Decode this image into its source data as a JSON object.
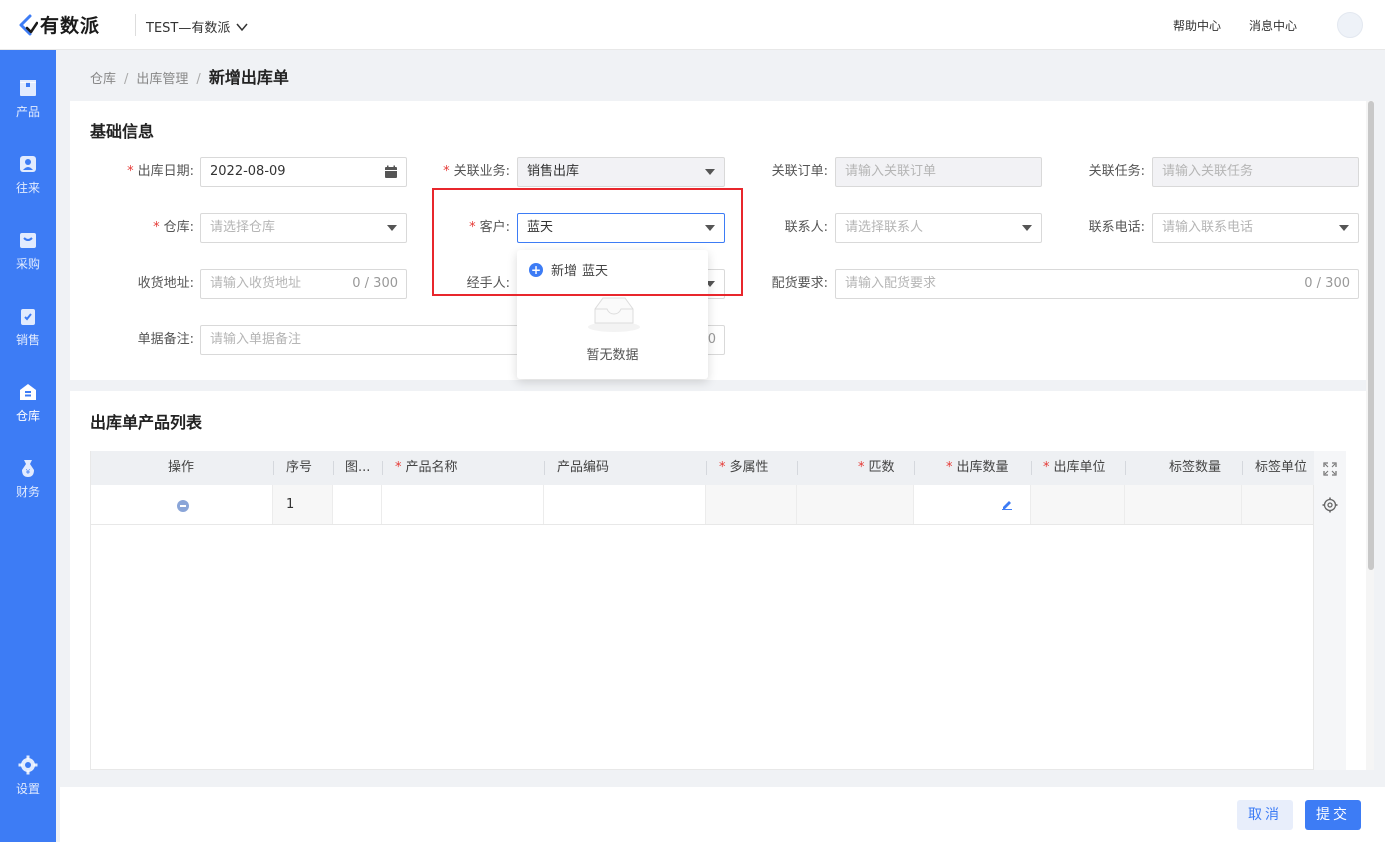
{
  "header": {
    "brand": "有数派",
    "company": "TEST—有数派",
    "help": "帮助中心",
    "messages": "消息中心"
  },
  "sidebar": {
    "items": [
      {
        "label": "产品",
        "icon": "box-icon"
      },
      {
        "label": "往来",
        "icon": "contacts-icon"
      },
      {
        "label": "采购",
        "icon": "cart-icon"
      },
      {
        "label": "销售",
        "icon": "sales-icon"
      },
      {
        "label": "仓库",
        "icon": "warehouse-icon",
        "active": true
      },
      {
        "label": "财务",
        "icon": "finance-icon"
      },
      {
        "label": "设置",
        "icon": "settings-icon"
      }
    ]
  },
  "breadcrumb": {
    "level1": "仓库",
    "level2": "出库管理",
    "current": "新增出库单"
  },
  "basic": {
    "title": "基础信息",
    "date_label": "出库日期",
    "date_value": "2022-08-09",
    "biz_label": "关联业务",
    "biz_value": "销售出库",
    "order_label": "关联订单",
    "order_ph": "请输入关联订单",
    "task_label": "关联任务",
    "task_ph": "请输入关联任务",
    "wh_label": "仓库",
    "wh_ph": "请选择仓库",
    "cust_label": "客户",
    "cust_value": "蓝天",
    "contact_label": "联系人",
    "contact_ph": "请选择联系人",
    "phone_label": "联系电话",
    "phone_ph": "请输入联系电话",
    "addr_label": "收货地址",
    "addr_ph": "请输入收货地址",
    "addr_count": "0 / 300",
    "handler_label": "经手人",
    "dist_label": "配货要求",
    "dist_ph": "请输入配货要求",
    "dist_count": "0 / 300",
    "remark_label": "单据备注",
    "remark_ph": "请输入单据备注",
    "remark_count_tail": "0"
  },
  "dropdown": {
    "add_prefix": "新增",
    "add_name": "蓝天",
    "empty": "暂无数据"
  },
  "products": {
    "title": "出库单产品列表",
    "columns": [
      "操作",
      "序号",
      "图...",
      "产品名称",
      "产品编码",
      "多属性",
      "匹数",
      "出库数量",
      "出库单位",
      "标签数量",
      "标签单位"
    ],
    "rows": [
      {
        "index": "1"
      }
    ]
  },
  "footer": {
    "cancel": "取消",
    "submit": "提交"
  },
  "colors": {
    "primary": "#3d7cf5",
    "required": "#e53935",
    "highlight": "#e8262c"
  }
}
